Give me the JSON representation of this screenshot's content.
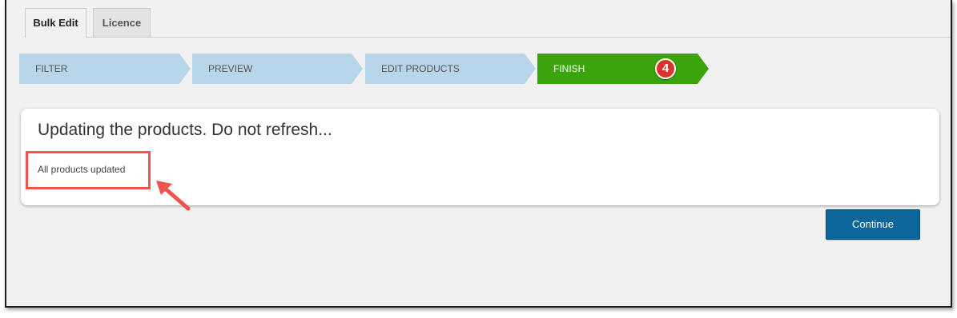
{
  "tabs": [
    {
      "label": "Bulk Edit",
      "active": true
    },
    {
      "label": "Licence",
      "active": false
    }
  ],
  "steps": [
    {
      "label": "FILTER"
    },
    {
      "label": "PREVIEW"
    },
    {
      "label": "EDIT PRODUCTS"
    },
    {
      "label": "FINISH",
      "active": true
    }
  ],
  "step_badge": "4",
  "panel": {
    "title": "Updating the products. Do not refresh...",
    "status": "All products updated"
  },
  "buttons": {
    "continue_label": "Continue"
  },
  "colors": {
    "step_inactive": "#b8d6ea",
    "step_active": "#3aa50b",
    "button": "#0d6699",
    "annotation": "#ef5350"
  }
}
